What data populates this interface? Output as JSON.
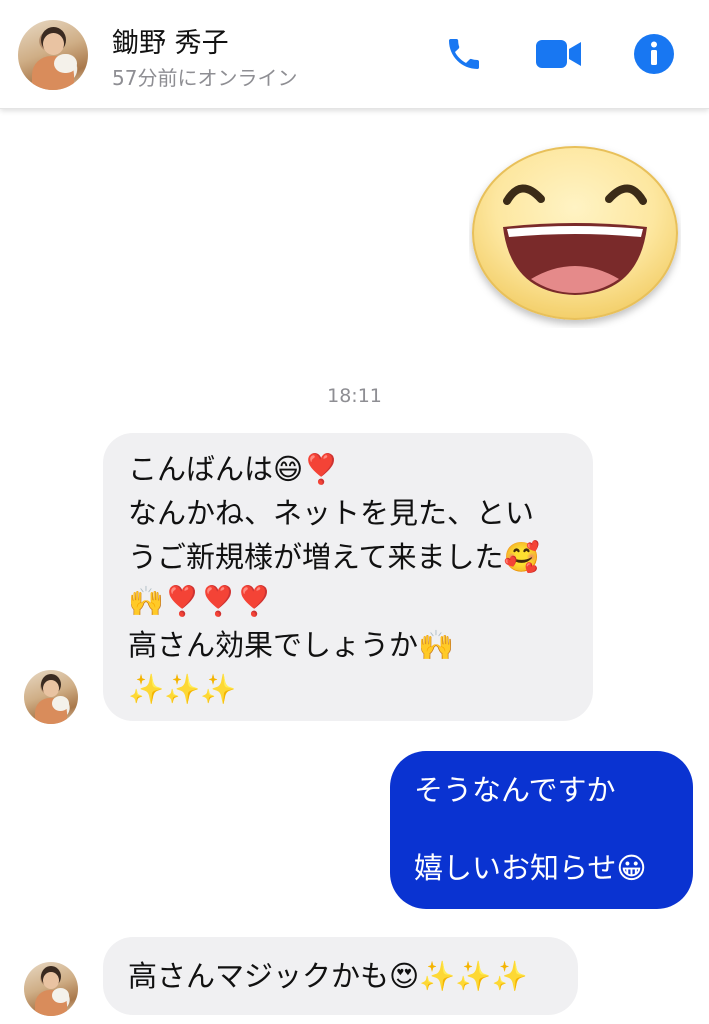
{
  "header": {
    "contact_name": "鋤野 秀子",
    "status": "57分前にオンライン",
    "icons": {
      "call": "phone-icon",
      "video": "video-camera-icon",
      "info": "info-icon"
    },
    "accent_color": "#1877f2"
  },
  "conversation": {
    "sent_sticker": "laughing-face-sticker",
    "timestamp": "18:11",
    "messages": [
      {
        "direction": "incoming",
        "lines": [
          "こんばんは😄❣️",
          "なんかね、ネットを見た、とい",
          "うご新規様が増えて来ました🥰",
          "🙌❣️❣️❣️",
          "高さん効果でしょうか🙌",
          "✨✨✨"
        ]
      },
      {
        "direction": "outgoing",
        "lines": [
          "そうなんですか",
          "嬉しいお知らせ😀"
        ]
      },
      {
        "direction": "incoming",
        "lines": [
          "高さんマジックかも😍✨✨✨"
        ]
      }
    ],
    "colors": {
      "incoming_bubble": "#f0f0f2",
      "outgoing_bubble": "#0a33d1"
    }
  }
}
